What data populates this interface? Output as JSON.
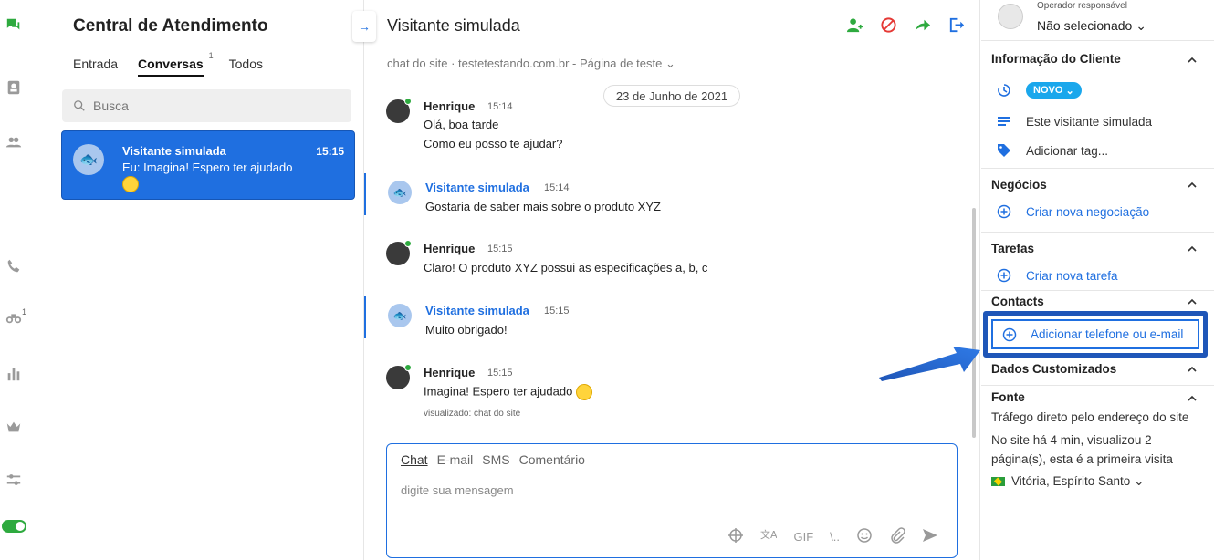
{
  "rail": {
    "icons": [
      "chat-icon",
      "contacts-card-icon",
      "people-icon",
      "phone-icon",
      "binoculars-icon",
      "bar-chart-icon",
      "crown-icon",
      "sliders-icon"
    ],
    "notification_count": "1",
    "active_color": "#2eaa3f"
  },
  "conversations": {
    "title": "Central de Atendimento",
    "tabs": [
      {
        "label": "Entrada"
      },
      {
        "label": "Conversas",
        "badge": "1",
        "active": true
      },
      {
        "label": "Todos"
      }
    ],
    "search_placeholder": "Busca",
    "items": [
      {
        "name": "Visitante simulada",
        "time": "15:15",
        "preview": "Eu: Imagina! Espero ter ajudado",
        "selected": true
      }
    ]
  },
  "chat": {
    "title": "Visitante simulada",
    "subtitle": "chat do site · testetestando.com.br - Página de teste",
    "date": "23 de Junho de 2021",
    "actions": [
      "add-user-icon",
      "block-icon",
      "forward-icon",
      "exit-icon"
    ],
    "messages": [
      {
        "author": "Henrique",
        "time": "15:14",
        "lines": [
          "Olá, boa tarde",
          "Como eu posso te ajudar?"
        ],
        "role": "agent"
      },
      {
        "author": "Visitante simulada",
        "time": "15:14",
        "lines": [
          "Gostaria de saber mais sobre o produto XYZ"
        ],
        "role": "visitor"
      },
      {
        "author": "Henrique",
        "time": "15:15",
        "lines": [
          "Claro! O produto XYZ possui as especificações a, b, c"
        ],
        "role": "agent"
      },
      {
        "author": "Visitante simulada",
        "time": "15:15",
        "lines": [
          "Muito obrigado!"
        ],
        "role": "visitor"
      },
      {
        "author": "Henrique",
        "time": "15:15",
        "lines": [
          "Imagina! Espero ter ajudado"
        ],
        "role": "agent",
        "seen": "visualizado: chat do site"
      }
    ],
    "composer": {
      "tabs": [
        "Chat",
        "E-mail",
        "SMS",
        "Comentário"
      ],
      "placeholder": "digite sua mensagem",
      "gif_label": "GIF",
      "shortcut_label": "\\.."
    }
  },
  "side": {
    "operator_label": "Operador responsável",
    "operator_value": "Não selecionado",
    "client_info": {
      "title": "Informação do Cliente",
      "status": "NOVO",
      "visitor": "Este visitante simulada",
      "tag": "Adicionar tag..."
    },
    "business": {
      "title": "Negócios",
      "action": "Criar nova negociação"
    },
    "tasks": {
      "title": "Tarefas",
      "action": "Criar nova tarefa"
    },
    "contacts": {
      "title": "Contacts",
      "action": "Adicionar telefone ou e-mail"
    },
    "custom": {
      "title": "Dados Customizados"
    },
    "source": {
      "title": "Fonte",
      "line1": "Tráfego direto pelo endereço do site",
      "line2": "No site há 4 min, visualizou 2",
      "line3": "página(s), esta é a primeira visita",
      "location": "Vitória, Espírito Santo"
    }
  },
  "colors": {
    "accent": "#1f6fe0",
    "green": "#2eaa3f",
    "red": "#e53935",
    "highlight_border": "#1f56b8"
  }
}
